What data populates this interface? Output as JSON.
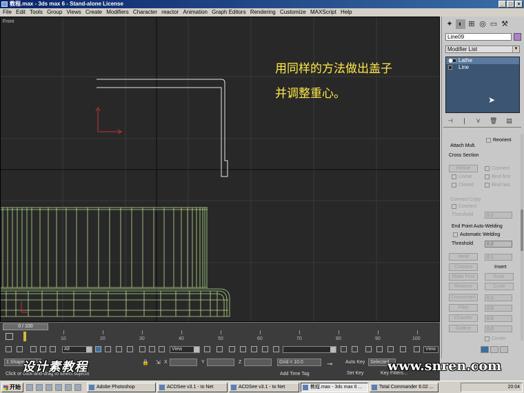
{
  "window": {
    "title": "教程.max - 3ds max 6 - Stand-alone License",
    "min": "_",
    "max": "□",
    "close": "×"
  },
  "menu": [
    "File",
    "Edit",
    "Tools",
    "Group",
    "Views",
    "Create",
    "Modifiers",
    "Character",
    "reactor",
    "Animation",
    "Graph Editors",
    "Rendering",
    "Customize",
    "MAXScript",
    "Help"
  ],
  "viewport": {
    "label": "Front",
    "note_line1": "用同样的方法做出盖子",
    "note_line2": "并调整重心。"
  },
  "command_panel": {
    "tab_icons": [
      "create-tab-icon",
      "modify-tab-icon",
      "hierarchy-tab-icon",
      "motion-tab-icon",
      "display-tab-icon",
      "utilities-tab-icon"
    ],
    "object_name": "Line09",
    "object_color": "#b07fd0",
    "modifier_list": "Modifier List",
    "stack": [
      {
        "label": "Lathe",
        "selected": true
      },
      {
        "label": "Line",
        "selected": false
      }
    ],
    "attach_mult": "Attach Mult.",
    "reorient": "Reorient",
    "cross_section": "Cross Section",
    "refine": "Refine",
    "connect": "Connect",
    "linear": "Linear",
    "closed": "Closed",
    "bind_first": "Bind first",
    "bind_last": "Bind last",
    "connect_copy": "Connect Copy",
    "connect2": "Connect",
    "threshold_a": "Threshold",
    "threshold_a_val": "0.1",
    "end_weld_title": "End Point Auto-Welding",
    "automatic_welding": "Automatic Welding",
    "threshold": "Threshold",
    "threshold_val": "6.0",
    "weld": "Weld",
    "weld_val": "0.1",
    "connect3": "Connect",
    "insert": "Insert",
    "make_first": "Make First",
    "fuse": "Fuse",
    "reverse": "Reverse",
    "cycle": "Cycle",
    "crossinsert": "CrossInsert",
    "crossinsert_val": "0.1",
    "fillet": "Fillet",
    "fillet_val": "0.0",
    "chamfer": "Chamfer",
    "chamfer_val": "0.0",
    "outline": "Outline",
    "outline_val": "0.0",
    "center": "Center"
  },
  "timeline": {
    "slider": "0 / 100",
    "ticks": [
      10,
      20,
      30,
      40,
      50,
      60,
      70,
      80,
      90,
      100
    ]
  },
  "toolbar2": {
    "select_filter": "All",
    "ref_coord": "View",
    "view_btn": "View"
  },
  "statusbar": {
    "shape_count": "1 Shape",
    "prompt": "Click or click-and-drag to select objects",
    "x_label": "X",
    "y_label": "Y",
    "z_label": "Z",
    "grid": "Grid = 10.0",
    "add_time_tag": "Add Time Tag",
    "auto_key": "Auto Key",
    "set_key": "Set Key",
    "selected": "Selected",
    "key_filters": "Key Filters...",
    "frame": "0"
  },
  "watermarks": {
    "logo": "设计素教程",
    "url": "www.snren.com"
  },
  "taskbar": {
    "start": "开始",
    "items": [
      {
        "label": "Adobe Photoshop",
        "active": false
      },
      {
        "label": "ACDSee v3.1 - to Net",
        "active": false
      },
      {
        "label": "ACDSee v3.1 - to Net",
        "active": false
      },
      {
        "label": "教程.max - 3ds max 6 ...",
        "active": true
      },
      {
        "label": "Total Commander 6.02 ...",
        "active": false
      }
    ],
    "clock": "20:04"
  }
}
